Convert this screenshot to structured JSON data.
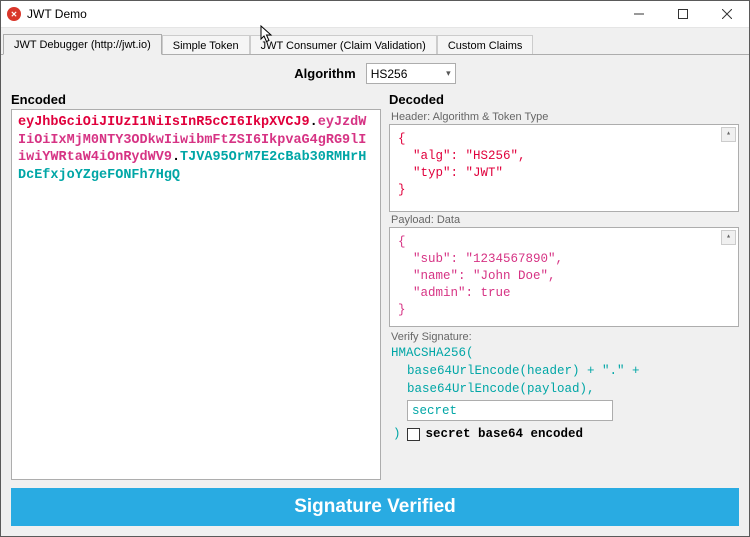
{
  "window": {
    "title": "JWT Demo"
  },
  "tabs": [
    {
      "label": "JWT Debugger (http://jwt.io)",
      "active": true
    },
    {
      "label": "Simple Token",
      "active": false
    },
    {
      "label": "JWT Consumer (Claim Validation)",
      "active": false
    },
    {
      "label": "Custom Claims",
      "active": false
    }
  ],
  "algorithm": {
    "label": "Algorithm",
    "value": "HS256"
  },
  "encoded": {
    "heading": "Encoded",
    "header_part": "eyJhbGciOiJIUzI1NiIsInR5cCI6IkpXVCJ9",
    "payload_part": "eyJzdWIiOiIxMjM0NTY3ODkwIiwibmFtZSI6IkpvaG4gRG9lIiwiYWRtaW4iOnRydWV9",
    "sig_part": "TJVA95OrM7E2cBab30RMHrHDcEfxjoYZgeFONFh7HgQ"
  },
  "decoded": {
    "heading": "Decoded",
    "header_section_label": "Header: Algorithm & Token Type",
    "header_json": "{\n  \"alg\": \"HS256\",\n  \"typ\": \"JWT\"\n}",
    "payload_section_label": "Payload: Data",
    "payload_json": "{\n  \"sub\": \"1234567890\",\n  \"name\": \"John Doe\",\n  \"admin\": true\n}",
    "signature_section_label": "Verify Signature:",
    "sig_line1": "HMACSHA256(",
    "sig_line2": "base64UrlEncode(header) + \".\" +",
    "sig_line3": "base64UrlEncode(payload),",
    "secret_value": "secret",
    "closing_paren": ")",
    "checkbox_label": "secret base64 encoded",
    "checkbox_checked": false
  },
  "status": {
    "text": "Signature Verified"
  }
}
